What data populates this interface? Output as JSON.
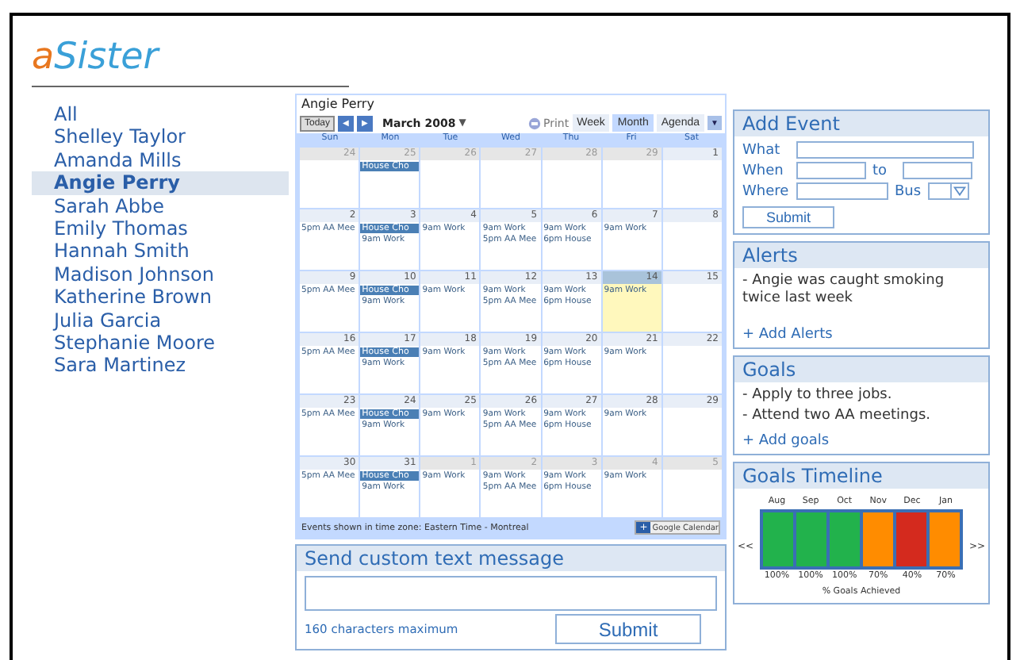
{
  "logo": {
    "accent": "a",
    "rest": "Sister"
  },
  "sidebar": {
    "items": [
      {
        "label": "All",
        "selected": false
      },
      {
        "label": "Shelley Taylor",
        "selected": false
      },
      {
        "label": "Amanda Mills",
        "selected": false
      },
      {
        "label": "Angie Perry",
        "selected": true
      },
      {
        "label": "Sarah Abbe",
        "selected": false
      },
      {
        "label": "Emily Thomas",
        "selected": false
      },
      {
        "label": "Hannah Smith",
        "selected": false
      },
      {
        "label": "Madison Johnson",
        "selected": false
      },
      {
        "label": "Katherine Brown",
        "selected": false
      },
      {
        "label": "Julia Garcia",
        "selected": false
      },
      {
        "label": "Stephanie Moore",
        "selected": false
      },
      {
        "label": "Sara Martinez",
        "selected": false
      }
    ]
  },
  "calendar": {
    "title": "Angie Perry",
    "today_button": "Today",
    "prev": "◀",
    "next": "▶",
    "month": "March 2008",
    "month_caret": "▼",
    "print": "Print",
    "views": [
      {
        "label": "Week",
        "selected": false
      },
      {
        "label": "Month",
        "selected": true
      },
      {
        "label": "Agenda",
        "selected": false
      }
    ],
    "view_menu": "▼",
    "weekdays": [
      "Sun",
      "Mon",
      "Tue",
      "Wed",
      "Thu",
      "Fri",
      "Sat"
    ],
    "weeks": [
      {
        "days": [
          {
            "date": "24",
            "other_month": true,
            "today": false
          },
          {
            "date": "25",
            "other_month": true,
            "today": false,
            "events": [
              {
                "kind": "chip",
                "text": "House Cho"
              }
            ]
          },
          {
            "date": "26",
            "other_month": true,
            "today": false
          },
          {
            "date": "27",
            "other_month": true,
            "today": false
          },
          {
            "date": "28",
            "other_month": true,
            "today": false
          },
          {
            "date": "29",
            "other_month": true,
            "today": false
          },
          {
            "date": "1",
            "other_month": false,
            "today": false
          }
        ]
      },
      {
        "days": [
          {
            "date": "2",
            "other_month": false,
            "today": false,
            "events": [
              {
                "kind": "plain",
                "text": "5pm AA Mee"
              }
            ]
          },
          {
            "date": "3",
            "other_month": false,
            "today": false,
            "events": [
              {
                "kind": "chip",
                "text": "House Cho"
              },
              {
                "kind": "plain",
                "text": "9am Work"
              }
            ]
          },
          {
            "date": "4",
            "other_month": false,
            "today": false,
            "events": [
              {
                "kind": "plain",
                "text": "9am Work"
              }
            ]
          },
          {
            "date": "5",
            "other_month": false,
            "today": false,
            "events": [
              {
                "kind": "plain",
                "text": "9am Work"
              },
              {
                "kind": "plain",
                "text": "5pm AA Mee"
              }
            ]
          },
          {
            "date": "6",
            "other_month": false,
            "today": false,
            "events": [
              {
                "kind": "plain",
                "text": "9am Work"
              },
              {
                "kind": "plain",
                "text": "6pm House"
              }
            ]
          },
          {
            "date": "7",
            "other_month": false,
            "today": false,
            "events": [
              {
                "kind": "plain",
                "text": "9am Work"
              }
            ]
          },
          {
            "date": "8",
            "other_month": false,
            "today": false
          }
        ]
      },
      {
        "days": [
          {
            "date": "9",
            "other_month": false,
            "today": false,
            "events": [
              {
                "kind": "plain",
                "text": "5pm AA Mee"
              }
            ]
          },
          {
            "date": "10",
            "other_month": false,
            "today": false,
            "events": [
              {
                "kind": "chip",
                "text": "House Cho"
              },
              {
                "kind": "plain",
                "text": "9am Work"
              }
            ]
          },
          {
            "date": "11",
            "other_month": false,
            "today": false,
            "events": [
              {
                "kind": "plain",
                "text": "9am Work"
              }
            ]
          },
          {
            "date": "12",
            "other_month": false,
            "today": false,
            "events": [
              {
                "kind": "plain",
                "text": "9am Work"
              },
              {
                "kind": "plain",
                "text": "5pm AA Mee"
              }
            ]
          },
          {
            "date": "13",
            "other_month": false,
            "today": false,
            "events": [
              {
                "kind": "plain",
                "text": "9am Work"
              },
              {
                "kind": "plain",
                "text": "6pm House"
              }
            ]
          },
          {
            "date": "14",
            "other_month": false,
            "today": true,
            "events": [
              {
                "kind": "plain",
                "text": "9am Work"
              }
            ]
          },
          {
            "date": "15",
            "other_month": false,
            "today": false
          }
        ]
      },
      {
        "days": [
          {
            "date": "16",
            "other_month": false,
            "today": false,
            "events": [
              {
                "kind": "plain",
                "text": "5pm AA Mee"
              }
            ]
          },
          {
            "date": "17",
            "other_month": false,
            "today": false,
            "events": [
              {
                "kind": "chip",
                "text": "House Cho"
              },
              {
                "kind": "plain",
                "text": "9am Work"
              }
            ]
          },
          {
            "date": "18",
            "other_month": false,
            "today": false,
            "events": [
              {
                "kind": "plain",
                "text": "9am Work"
              }
            ]
          },
          {
            "date": "19",
            "other_month": false,
            "today": false,
            "events": [
              {
                "kind": "plain",
                "text": "9am Work"
              },
              {
                "kind": "plain",
                "text": "5pm AA Mee"
              }
            ]
          },
          {
            "date": "20",
            "other_month": false,
            "today": false,
            "events": [
              {
                "kind": "plain",
                "text": "9am Work"
              },
              {
                "kind": "plain",
                "text": "6pm House"
              }
            ]
          },
          {
            "date": "21",
            "other_month": false,
            "today": false,
            "events": [
              {
                "kind": "plain",
                "text": "9am Work"
              }
            ]
          },
          {
            "date": "22",
            "other_month": false,
            "today": false
          }
        ]
      },
      {
        "days": [
          {
            "date": "23",
            "other_month": false,
            "today": false,
            "events": [
              {
                "kind": "plain",
                "text": "5pm AA Mee"
              }
            ]
          },
          {
            "date": "24",
            "other_month": false,
            "today": false,
            "events": [
              {
                "kind": "chip",
                "text": "House Cho"
              },
              {
                "kind": "plain",
                "text": "9am Work"
              }
            ]
          },
          {
            "date": "25",
            "other_month": false,
            "today": false,
            "events": [
              {
                "kind": "plain",
                "text": "9am Work"
              }
            ]
          },
          {
            "date": "26",
            "other_month": false,
            "today": false,
            "events": [
              {
                "kind": "plain",
                "text": "9am Work"
              },
              {
                "kind": "plain",
                "text": "5pm AA Mee"
              }
            ]
          },
          {
            "date": "27",
            "other_month": false,
            "today": false,
            "events": [
              {
                "kind": "plain",
                "text": "9am Work"
              },
              {
                "kind": "plain",
                "text": "6pm House"
              }
            ]
          },
          {
            "date": "28",
            "other_month": false,
            "today": false,
            "events": [
              {
                "kind": "plain",
                "text": "9am Work"
              }
            ]
          },
          {
            "date": "29",
            "other_month": false,
            "today": false
          }
        ]
      },
      {
        "days": [
          {
            "date": "30",
            "other_month": false,
            "today": false,
            "events": [
              {
                "kind": "plain",
                "text": "5pm AA Mee"
              }
            ]
          },
          {
            "date": "31",
            "other_month": false,
            "today": false,
            "events": [
              {
                "kind": "chip",
                "text": "House Cho"
              },
              {
                "kind": "plain",
                "text": "9am Work"
              }
            ]
          },
          {
            "date": "1",
            "other_month": true,
            "today": false,
            "events": [
              {
                "kind": "plain",
                "text": "9am Work"
              }
            ]
          },
          {
            "date": "2",
            "other_month": true,
            "today": false,
            "events": [
              {
                "kind": "plain",
                "text": "9am Work"
              },
              {
                "kind": "plain",
                "text": "5pm AA Mee"
              }
            ]
          },
          {
            "date": "3",
            "other_month": true,
            "today": false,
            "events": [
              {
                "kind": "plain",
                "text": "9am Work"
              },
              {
                "kind": "plain",
                "text": "6pm House"
              }
            ]
          },
          {
            "date": "4",
            "other_month": true,
            "today": false,
            "events": [
              {
                "kind": "plain",
                "text": "9am Work"
              }
            ]
          },
          {
            "date": "5",
            "other_month": true,
            "today": false
          }
        ]
      }
    ],
    "footer": "Events shown in time zone: Eastern Time - Montreal",
    "badge_plus": "+",
    "badge_label": "Google Calendar"
  },
  "message": {
    "title": "Send custom text message",
    "hint": "160 characters maximum",
    "submit": "Submit"
  },
  "add_event": {
    "title": "Add Event",
    "what": "What",
    "when": "When",
    "to": "to",
    "where": "Where",
    "bus": "Bus",
    "submit": "Submit"
  },
  "alerts": {
    "title": "Alerts",
    "items": [
      "- Angie was caught smoking twice last week"
    ],
    "add": "+ Add Alerts"
  },
  "goals": {
    "title": "Goals",
    "items": [
      "- Apply to three jobs.",
      "- Attend two AA meetings."
    ],
    "add": "+ Add goals"
  },
  "timeline": {
    "title": "Goals Timeline",
    "prev": "<<",
    "next": ">>",
    "caption": "% Goals Achieved",
    "months": [
      {
        "month": "Aug",
        "value": "100%",
        "color": "#22b24c"
      },
      {
        "month": "Sep",
        "value": "100%",
        "color": "#22b24c"
      },
      {
        "month": "Oct",
        "value": "100%",
        "color": "#22b24c"
      },
      {
        "month": "Nov",
        "value": "70%",
        "color": "#ff8c00"
      },
      {
        "month": "Dec",
        "value": "40%",
        "color": "#d42a1e"
      },
      {
        "month": "Jan",
        "value": "70%",
        "color": "#ff8c00"
      }
    ]
  }
}
